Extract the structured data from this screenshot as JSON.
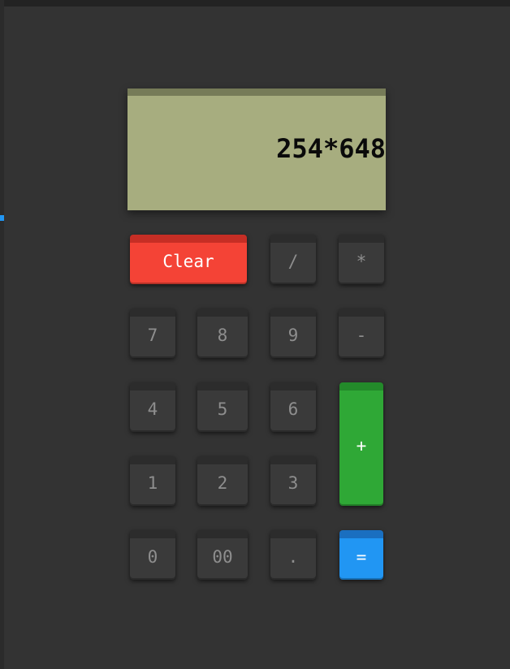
{
  "display": {
    "value": "254*648"
  },
  "keys": {
    "clear": "Clear",
    "divide": "/",
    "multiply": "*",
    "seven": "7",
    "eight": "8",
    "nine": "9",
    "minus": "-",
    "four": "4",
    "five": "5",
    "six": "6",
    "plus": "+",
    "one": "1",
    "two": "2",
    "three": "3",
    "zero": "0",
    "double_zero": "00",
    "decimal": ".",
    "equals": "="
  },
  "colors": {
    "background": "#333333",
    "display": "#a7ad7f",
    "clear": "#f44336",
    "plus": "#2fa836",
    "equals": "#2196f3",
    "key": "#3a3a3a"
  }
}
